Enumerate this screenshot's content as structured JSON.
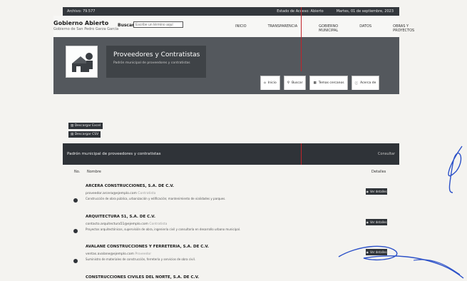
{
  "topbar": {
    "left_text": "Archivo: 79.577",
    "right_items": [
      "Estado de Acceso: Abierto",
      "Martes, 01 de septiembre, 2023"
    ]
  },
  "header": {
    "brand_title": "Gobierno Abierto",
    "brand_sub": "Gobierno de San Pedro Garza García",
    "search_label": "Buscar",
    "search_placeholder": "Escribe un término aquí",
    "nav": [
      "INICIO",
      "TRANSPARENCIA",
      "GOBIERNO MUNICIPAL",
      "DATOS",
      "OBRAS Y PROYECTOS"
    ]
  },
  "hero": {
    "title": "Proveedores y Contratistas",
    "subtitle": "Padrón municipal de proveedores y contratistas"
  },
  "tabs": [
    {
      "label": "Inicio",
      "icon": "home-icon"
    },
    {
      "label": "Buscar",
      "icon": "search-icon"
    },
    {
      "label": "Temas cercanos",
      "icon": "grid-icon"
    },
    {
      "label": "Acerca de",
      "icon": "info-icon"
    }
  ],
  "actions": {
    "btn1": "Descargar Excel",
    "btn2": "Descargar CSV"
  },
  "panel": {
    "title": "Padrón municipal de proveedores y contratistas",
    "link": "Consultar"
  },
  "table": {
    "headers": [
      "No.",
      "Nombre",
      "Detalles"
    ],
    "rows": [
      {
        "name": "ARCERA CONSTRUCCIONES, S.A. DE C.V.",
        "email": "proveedor.arcera@ejemplo.com",
        "tag": "Contratista",
        "desc": "Construcción de obra pública, urbanización y edificación; mantenimiento de vialidades y parques.",
        "button": "Ver detalles"
      },
      {
        "name": "ARQUITECTURA 51, S.A. DE C.V.",
        "email": "contacto.arquitectura51@ejemplo.com",
        "tag": "Contratista",
        "desc": "Proyectos arquitectónicos, supervisión de obra, ingeniería civil y consultoría en desarrollo urbano municipal.",
        "button": "Ver detalles"
      },
      {
        "name": "AVALANE CONSTRUCCIONES Y FERRETERIA, S.A. DE C.V.",
        "email": "ventas.avalane@ejemplo.com",
        "tag": "Proveedor",
        "desc": "Suministro de materiales de construcción, ferretería y servicios de obra civil.",
        "button": "Ver detalles"
      },
      {
        "name": "CONSTRUCCIONES CIVILES DEL NORTE, S.A. DE C.V.",
        "email": "",
        "tag": "",
        "desc": "",
        "button": ""
      }
    ]
  },
  "colors": {
    "dark": "#2f3338",
    "hero": "#54585d",
    "red_line": "#c0242a",
    "signature": "#2b50c8"
  }
}
